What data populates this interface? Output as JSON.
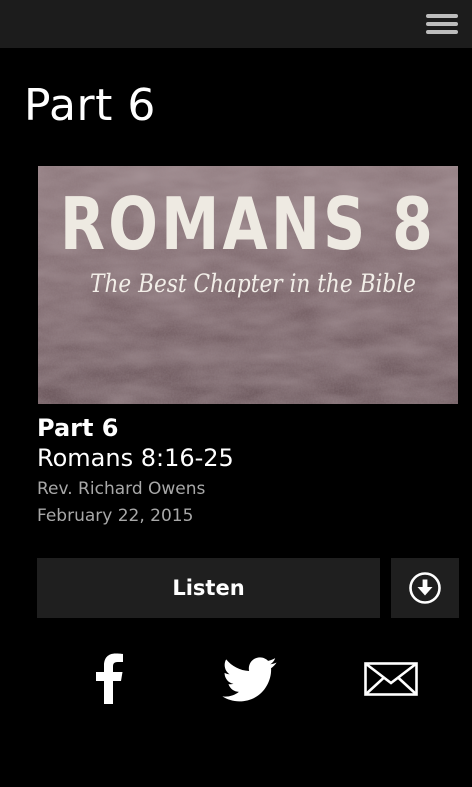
{
  "header": {
    "menu_icon": "hamburger-menu-icon"
  },
  "page": {
    "title": "Part 6"
  },
  "artwork": {
    "series_title": "ROMANS 8",
    "subtitle": "The Best Chapter in the Bible"
  },
  "sermon": {
    "title": "Part 6",
    "scripture": "Romans 8:16-25",
    "speaker": "Rev. Richard Owens",
    "date": "February 22, 2015"
  },
  "actions": {
    "listen_label": "Listen",
    "download_icon": "download-circle-icon"
  },
  "share": {
    "icons": [
      "facebook-icon",
      "twitter-icon",
      "email-icon"
    ]
  },
  "colors": {
    "background": "#000000",
    "topbar": "#1c1c1c",
    "button_bg": "#1f1f1f",
    "secondary_text": "#a8a8a8",
    "artwork_bg": "#7a6468"
  }
}
